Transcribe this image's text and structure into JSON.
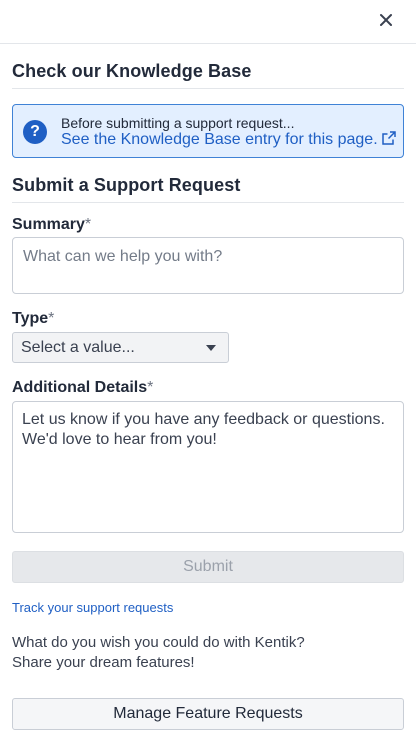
{
  "header": {
    "close_icon": "close-icon"
  },
  "knowledge_base": {
    "title": "Check our Knowledge Base",
    "notice_line": "Before submitting a support request...",
    "link_text": "See the Knowledge Base entry for this page.",
    "help_icon": "question-circle-icon",
    "external_icon": "external-link-icon",
    "accent_color": "#1f5fc4",
    "box_background": "#e3efff"
  },
  "support_form": {
    "title": "Submit a Support Request",
    "summary": {
      "label": "Summary",
      "required_mark": "*",
      "placeholder": "What can we help you with?",
      "value": ""
    },
    "type": {
      "label": "Type",
      "required_mark": "*",
      "selected": "Select a value..."
    },
    "details": {
      "label": "Additional Details",
      "required_mark": "*",
      "value": "Let us know if you have any feedback or questions. We'd love to hear from you!"
    },
    "submit_label": "Submit"
  },
  "footer": {
    "track_link": "Track your support requests",
    "dream_line1": "What do you wish you could do with Kentik?",
    "dream_line2": "Share your dream features!",
    "manage_button": "Manage Feature Requests"
  }
}
